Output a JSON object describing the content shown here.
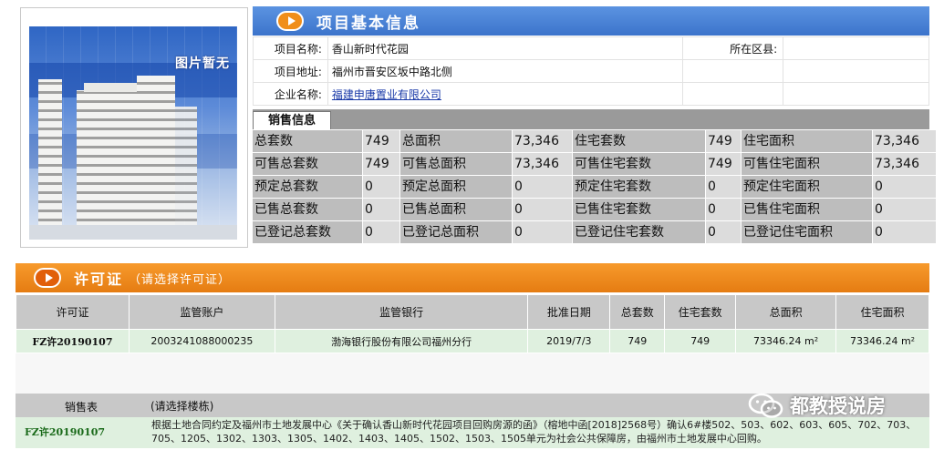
{
  "photo": {
    "label": "图片暂无"
  },
  "project": {
    "header_title": "项目基本信息",
    "rows": [
      {
        "label": "项目名称:",
        "value": "香山新时代花园",
        "label2": "所在区县:",
        "value2": ""
      },
      {
        "label": "项目地址:",
        "value": "福州市晋安区坂中路北侧"
      },
      {
        "label": "企业名称:",
        "value": "福建申唐置业有限公司"
      }
    ]
  },
  "sales": {
    "tab_label": "销售信息",
    "rows": [
      [
        "总套数",
        "749",
        "总面积",
        "73,346",
        "住宅套数",
        "749",
        "住宅面积",
        "73,346"
      ],
      [
        "可售总套数",
        "749",
        "可售总面积",
        "73,346",
        "可售住宅套数",
        "749",
        "可售住宅面积",
        "73,346"
      ],
      [
        "预定总套数",
        "0",
        "预定总面积",
        "0",
        "预定住宅套数",
        "0",
        "预定住宅面积",
        "0"
      ],
      [
        "已售总套数",
        "0",
        "已售总面积",
        "0",
        "已售住宅套数",
        "0",
        "已售住宅面积",
        "0"
      ],
      [
        "已登记总套数",
        "0",
        "已登记总面积",
        "0",
        "已登记住宅套数",
        "0",
        "已登记住宅面积",
        "0"
      ]
    ]
  },
  "permit": {
    "title": "许可证",
    "subtitle": "（请选择许可证）",
    "columns": [
      "许可证",
      "监管账户",
      "监管银行",
      "批准日期",
      "总套数",
      "住宅套数",
      "总面积",
      "住宅面积"
    ],
    "rows": [
      [
        "FZ许20190107",
        "2003241088000235",
        "渤海银行股份有限公司福州分行",
        "2019/7/3",
        "749",
        "749",
        "73346.24 m²",
        "73346.24 m²"
      ]
    ]
  },
  "salebook": {
    "col1": "销售表",
    "col2": "(请选择楼栋)",
    "permit_id": "FZ许20190107",
    "note": "根据土地合同约定及福州市土地发展中心《关于确认香山新时代花园项目回购房源的函》（榕地中函[2018]2568号）确认6#楼502、503、602、603、605、702、703、705、1205、1302、1303、1305、1402、1403、1405、1502、1503、1505单元为社会公共保障房，由福州市土地发展中心回购。"
  },
  "watermark": {
    "text": "都教授说房",
    "icon": "wechat-icon"
  },
  "colors": {
    "blue_header": "#3c74cb",
    "orange_header": "#e57c12",
    "row_green": "#dff0df",
    "gray_key": "#bdbdbd",
    "gray_val": "#dcdcdc"
  }
}
